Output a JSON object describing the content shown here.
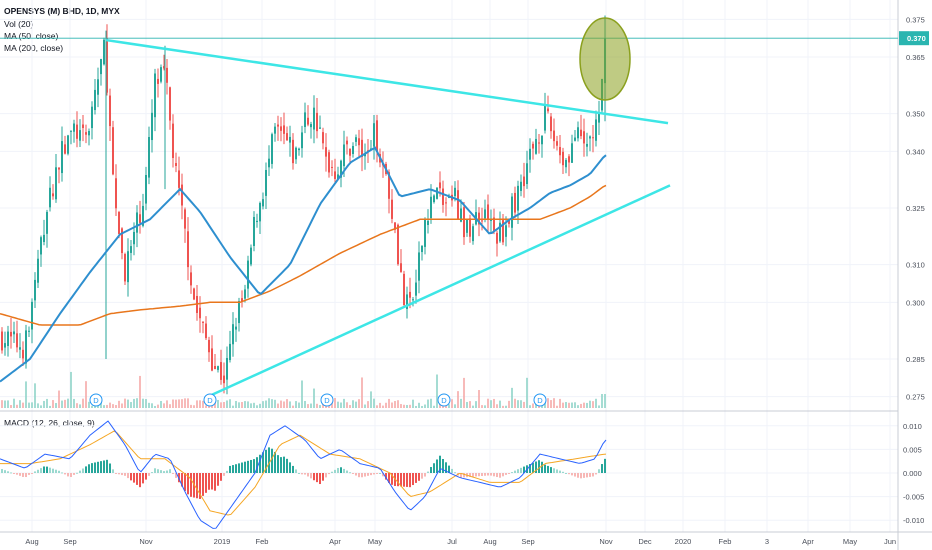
{
  "header": {
    "symbol": "OPENSYS (M) BHD, 1D, MYX",
    "vol": "Vol (20)",
    "ma50": "MA (50, close)",
    "ma200": "MA (200, close)",
    "macd": "MACD (12, 26, close, 9)"
  },
  "colors": {
    "up": "#26a69a",
    "down": "#ef5350",
    "ma50": "#2e8fcf",
    "ma200": "#e8761c",
    "trendline": "#3de6e6",
    "macd_line": "#2962ff",
    "signal_line": "#f5a623",
    "highlight": "#8ba01e",
    "price_tag": "#2ab5b0"
  },
  "chart_data": {
    "type": "candlestick",
    "price_axis": {
      "ticks": [
        "0.375",
        "0.365",
        "0.350",
        "0.340",
        "0.325",
        "0.310",
        "0.300",
        "0.285",
        "0.275"
      ],
      "ylim": [
        0.272,
        0.378
      ],
      "last_price": "0.370"
    },
    "macd_axis": {
      "ticks": [
        "0.010",
        "0.005",
        "0.000",
        "-0.005",
        "-0.010"
      ],
      "ylim": [
        -0.0125,
        0.0125
      ]
    },
    "time_axis": [
      "Aug",
      "Sep",
      "Nov",
      "2019",
      "Feb",
      "Apr",
      "May",
      "Jul",
      "Aug",
      "Sep",
      "Nov",
      "Dec",
      "2020",
      "Feb",
      "3",
      "Apr",
      "May",
      "Jun"
    ],
    "dividend_markers": [
      "D",
      "D",
      "D",
      "D",
      "D"
    ],
    "price_keypoints": [
      [
        0,
        0.291
      ],
      [
        25,
        0.288
      ],
      [
        45,
        0.322
      ],
      [
        60,
        0.339
      ],
      [
        75,
        0.346
      ],
      [
        85,
        0.342
      ],
      [
        95,
        0.356
      ],
      [
        105,
        0.368
      ],
      [
        115,
        0.323
      ],
      [
        125,
        0.309
      ],
      [
        135,
        0.318
      ],
      [
        145,
        0.33
      ],
      [
        155,
        0.358
      ],
      [
        165,
        0.36
      ],
      [
        175,
        0.335
      ],
      [
        185,
        0.318
      ],
      [
        195,
        0.299
      ],
      [
        205,
        0.291
      ],
      [
        215,
        0.283
      ],
      [
        225,
        0.28
      ],
      [
        235,
        0.295
      ],
      [
        245,
        0.302
      ],
      [
        255,
        0.322
      ],
      [
        265,
        0.332
      ],
      [
        275,
        0.345
      ],
      [
        285,
        0.343
      ],
      [
        295,
        0.338
      ],
      [
        305,
        0.348
      ],
      [
        315,
        0.35
      ],
      [
        325,
        0.338
      ],
      [
        335,
        0.335
      ],
      [
        345,
        0.34
      ],
      [
        355,
        0.343
      ],
      [
        365,
        0.338
      ],
      [
        375,
        0.345
      ],
      [
        385,
        0.335
      ],
      [
        395,
        0.32
      ],
      [
        405,
        0.298
      ],
      [
        415,
        0.302
      ],
      [
        425,
        0.322
      ],
      [
        435,
        0.33
      ],
      [
        445,
        0.326
      ],
      [
        455,
        0.328
      ],
      [
        465,
        0.318
      ],
      [
        475,
        0.322
      ],
      [
        485,
        0.325
      ],
      [
        495,
        0.317
      ],
      [
        505,
        0.32
      ],
      [
        515,
        0.327
      ],
      [
        525,
        0.335
      ],
      [
        535,
        0.343
      ],
      [
        545,
        0.349
      ],
      [
        555,
        0.343
      ],
      [
        565,
        0.337
      ],
      [
        575,
        0.344
      ],
      [
        585,
        0.341
      ],
      [
        595,
        0.346
      ],
      [
        600,
        0.348
      ],
      [
        605,
        0.37
      ]
    ],
    "ma50_keypoints": [
      [
        0,
        0.279
      ],
      [
        30,
        0.285
      ],
      [
        60,
        0.297
      ],
      [
        90,
        0.308
      ],
      [
        120,
        0.318
      ],
      [
        150,
        0.322
      ],
      [
        180,
        0.33
      ],
      [
        200,
        0.324
      ],
      [
        230,
        0.312
      ],
      [
        260,
        0.302
      ],
      [
        290,
        0.31
      ],
      [
        320,
        0.326
      ],
      [
        350,
        0.337
      ],
      [
        375,
        0.341
      ],
      [
        400,
        0.328
      ],
      [
        430,
        0.33
      ],
      [
        460,
        0.327
      ],
      [
        490,
        0.318
      ],
      [
        510,
        0.322
      ],
      [
        530,
        0.325
      ],
      [
        550,
        0.329
      ],
      [
        570,
        0.331
      ],
      [
        590,
        0.334
      ],
      [
        605,
        0.339
      ]
    ],
    "ma200_keypoints": [
      [
        0,
        0.297
      ],
      [
        40,
        0.294
      ],
      [
        80,
        0.294
      ],
      [
        110,
        0.297
      ],
      [
        140,
        0.298
      ],
      [
        180,
        0.299
      ],
      [
        210,
        0.3
      ],
      [
        240,
        0.3
      ],
      [
        270,
        0.303
      ],
      [
        300,
        0.307
      ],
      [
        340,
        0.313
      ],
      [
        380,
        0.318
      ],
      [
        420,
        0.322
      ],
      [
        460,
        0.322
      ],
      [
        500,
        0.322
      ],
      [
        540,
        0.322
      ],
      [
        570,
        0.325
      ],
      [
        590,
        0.328
      ],
      [
        605,
        0.331
      ]
    ],
    "macd_keypoints": [
      [
        0,
        0.003
      ],
      [
        25,
        0.001
      ],
      [
        45,
        0.004
      ],
      [
        70,
        0.003
      ],
      [
        90,
        0.008
      ],
      [
        108,
        0.011
      ],
      [
        125,
        0.006
      ],
      [
        140,
        0.0
      ],
      [
        155,
        0.004
      ],
      [
        170,
        0.003
      ],
      [
        185,
        -0.004
      ],
      [
        200,
        -0.01
      ],
      [
        215,
        -0.012
      ],
      [
        235,
        -0.006
      ],
      [
        255,
        0.0
      ],
      [
        270,
        0.008
      ],
      [
        285,
        0.01
      ],
      [
        305,
        0.007
      ],
      [
        320,
        0.003
      ],
      [
        340,
        0.005
      ],
      [
        360,
        0.002
      ],
      [
        380,
        0.001
      ],
      [
        395,
        -0.004
      ],
      [
        410,
        -0.008
      ],
      [
        425,
        -0.005
      ],
      [
        440,
        0.001
      ],
      [
        460,
        -0.001
      ],
      [
        480,
        -0.002
      ],
      [
        500,
        -0.003
      ],
      [
        520,
        -0.001
      ],
      [
        540,
        0.004
      ],
      [
        560,
        0.003
      ],
      [
        580,
        0.002
      ],
      [
        595,
        0.003
      ],
      [
        605,
        0.007
      ]
    ],
    "signal_keypoints": [
      [
        0,
        0.002
      ],
      [
        30,
        0.002
      ],
      [
        60,
        0.003
      ],
      [
        90,
        0.006
      ],
      [
        115,
        0.009
      ],
      [
        140,
        0.003
      ],
      [
        165,
        0.003
      ],
      [
        190,
        -0.001
      ],
      [
        210,
        -0.008
      ],
      [
        230,
        -0.009
      ],
      [
        255,
        -0.003
      ],
      [
        280,
        0.006
      ],
      [
        300,
        0.008
      ],
      [
        330,
        0.004
      ],
      [
        360,
        0.003
      ],
      [
        390,
        0.0
      ],
      [
        410,
        -0.005
      ],
      [
        430,
        -0.004
      ],
      [
        460,
        0.0
      ],
      [
        490,
        -0.002
      ],
      [
        520,
        -0.002
      ],
      [
        545,
        0.002
      ],
      [
        575,
        0.003
      ],
      [
        605,
        0.004
      ]
    ]
  }
}
